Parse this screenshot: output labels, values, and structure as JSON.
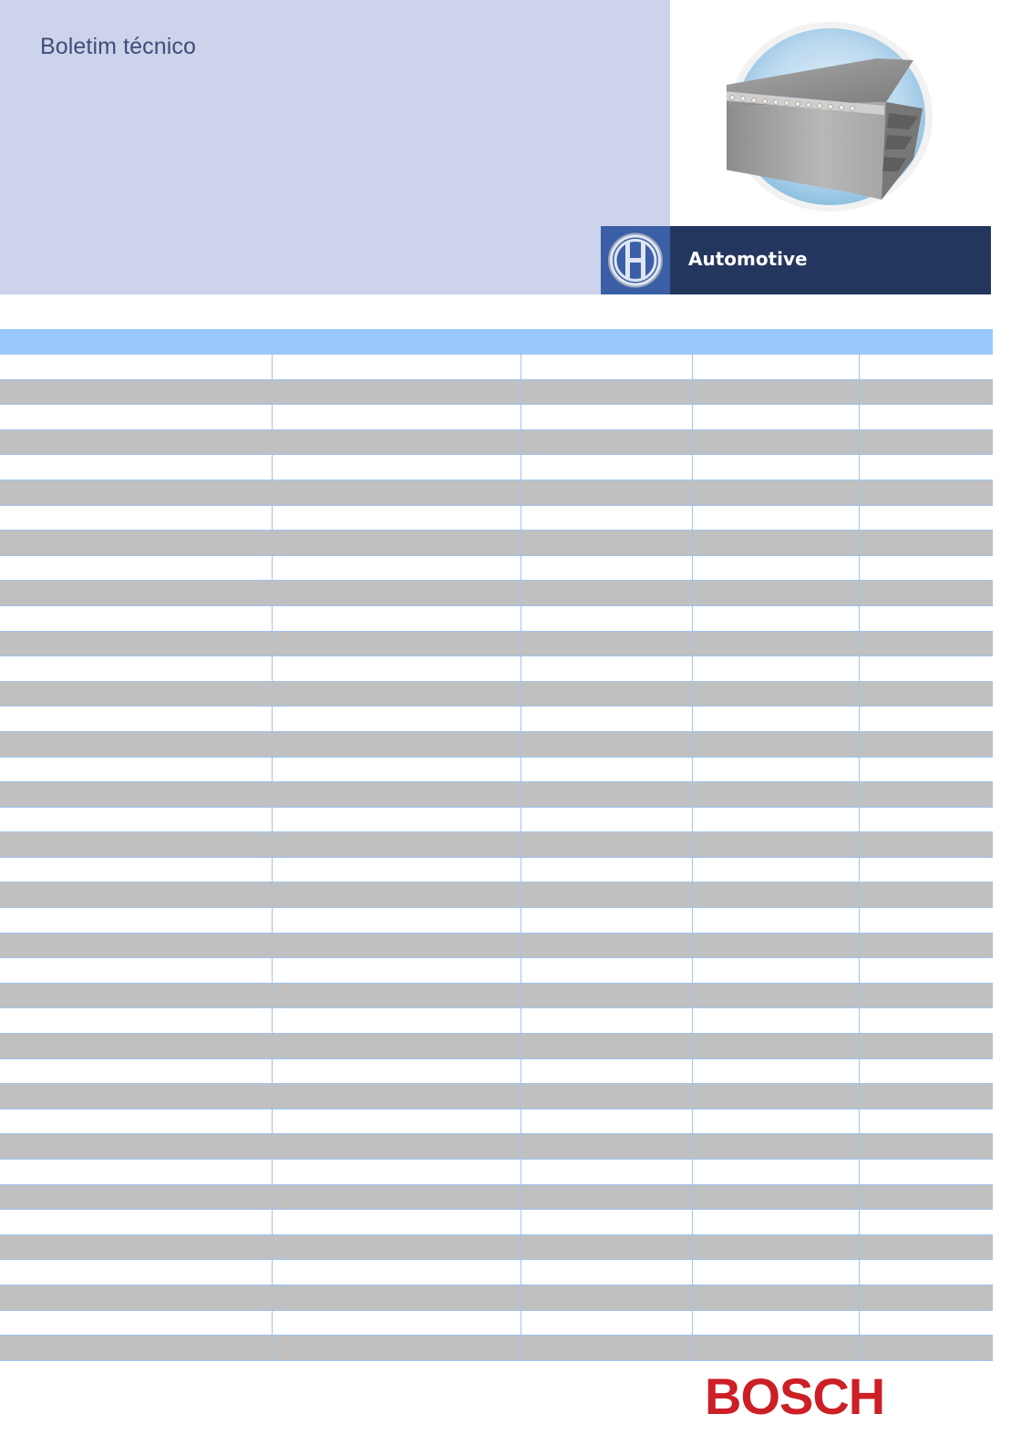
{
  "header": {
    "title": "Boletim técnico",
    "division": "Automotive"
  },
  "brand": {
    "wordmark": "BOSCH",
    "accent_color": "#cc1f26",
    "panel_color": "#cdd3ea",
    "division_bar_color": "#23365e",
    "logo_box_color": "#3b5fa6",
    "table_header_color": "#99c9fb",
    "row_shade_color": "#c0c0c0"
  },
  "images": {
    "product": "v-belt-cross-section-image",
    "logo": "bosch-armature-logo-icon"
  },
  "table": {
    "column_count": 5,
    "headers": [
      "",
      "",
      "",
      "",
      ""
    ],
    "rows": [
      [
        "",
        "",
        "",
        "",
        ""
      ],
      [
        "",
        "",
        "",
        "",
        ""
      ],
      [
        "",
        "",
        "",
        "",
        ""
      ],
      [
        "",
        "",
        "",
        "",
        ""
      ],
      [
        "",
        "",
        "",
        "",
        ""
      ],
      [
        "",
        "",
        "",
        "",
        ""
      ],
      [
        "",
        "",
        "",
        "",
        ""
      ],
      [
        "",
        "",
        "",
        "",
        ""
      ],
      [
        "",
        "",
        "",
        "",
        ""
      ],
      [
        "",
        "",
        "",
        "",
        ""
      ],
      [
        "",
        "",
        "",
        "",
        ""
      ],
      [
        "",
        "",
        "",
        "",
        ""
      ],
      [
        "",
        "",
        "",
        "",
        ""
      ],
      [
        "",
        "",
        "",
        "",
        ""
      ],
      [
        "",
        "",
        "",
        "",
        ""
      ],
      [
        "",
        "",
        "",
        "",
        ""
      ],
      [
        "",
        "",
        "",
        "",
        ""
      ],
      [
        "",
        "",
        "",
        "",
        ""
      ],
      [
        "",
        "",
        "",
        "",
        ""
      ],
      [
        "",
        "",
        "",
        "",
        ""
      ],
      [
        "",
        "",
        "",
        "",
        ""
      ],
      [
        "",
        "",
        "",
        "",
        ""
      ],
      [
        "",
        "",
        "",
        "",
        ""
      ],
      [
        "",
        "",
        "",
        "",
        ""
      ],
      [
        "",
        "",
        "",
        "",
        ""
      ],
      [
        "",
        "",
        "",
        "",
        ""
      ],
      [
        "",
        "",
        "",
        "",
        ""
      ],
      [
        "",
        "",
        "",
        "",
        ""
      ],
      [
        "",
        "",
        "",
        "",
        ""
      ],
      [
        "",
        "",
        "",
        "",
        ""
      ],
      [
        "",
        "",
        "",
        "",
        ""
      ],
      [
        "",
        "",
        "",
        "",
        ""
      ],
      [
        "",
        "",
        "",
        "",
        ""
      ],
      [
        "",
        "",
        "",
        "",
        ""
      ],
      [
        "",
        "",
        "",
        "",
        ""
      ],
      [
        "",
        "",
        "",
        "",
        ""
      ],
      [
        "",
        "",
        "",
        "",
        ""
      ],
      [
        "",
        "",
        "",
        "",
        ""
      ],
      [
        "",
        "",
        "",
        "",
        ""
      ],
      [
        "",
        "",
        "",
        "",
        ""
      ]
    ]
  }
}
